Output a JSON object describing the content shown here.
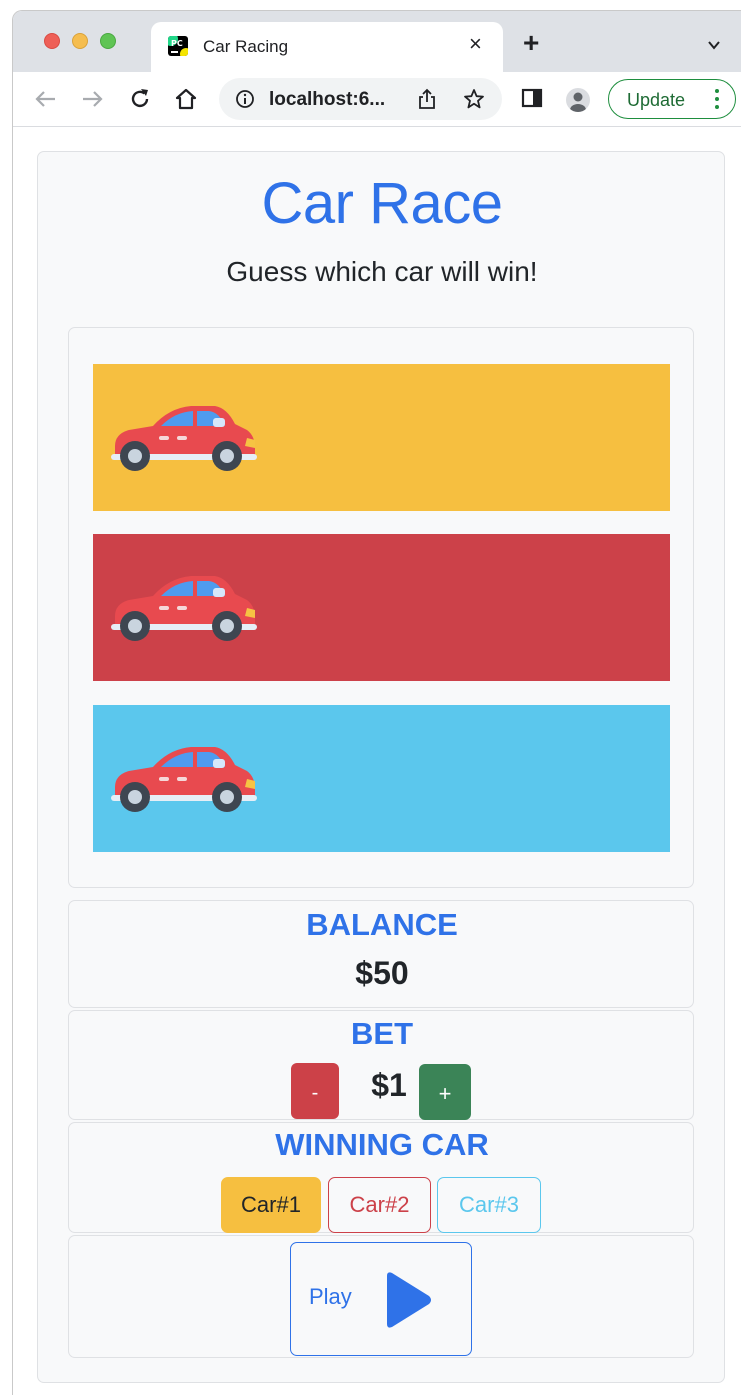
{
  "browser": {
    "tab_title": "Car Racing",
    "tab_close": "×",
    "new_tab": "+",
    "address": "localhost:6...",
    "update_label": "Update"
  },
  "page": {
    "title": "Car Race",
    "subtitle": "Guess which car will win!"
  },
  "lanes": [
    {
      "color": "#f6bf40",
      "car": "red-car-icon"
    },
    {
      "color": "#cc4149",
      "car": "red-car-icon"
    },
    {
      "color": "#5bc7ed",
      "car": "red-car-icon"
    }
  ],
  "balance": {
    "label": "BALANCE",
    "value": "$50"
  },
  "bet": {
    "label": "BET",
    "minus": "-",
    "value": "$1",
    "plus": "+"
  },
  "winning_car": {
    "label": "WINNING CAR",
    "options": [
      {
        "label": "Car#1",
        "selected": true,
        "color": "#f6bf40"
      },
      {
        "label": "Car#2",
        "selected": false,
        "color": "#cc4149"
      },
      {
        "label": "Car#3",
        "selected": false,
        "color": "#5bc7ed"
      }
    ]
  },
  "play": {
    "label": "Play",
    "icon": "play-icon"
  },
  "colors": {
    "accent": "#2f72e8",
    "text": "#212529"
  }
}
